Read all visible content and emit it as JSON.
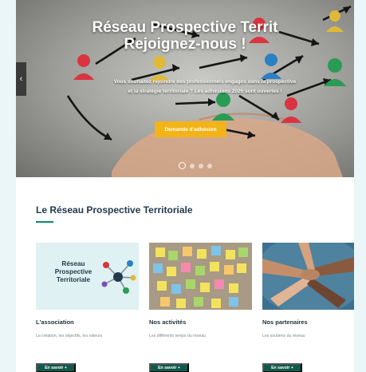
{
  "hero": {
    "title_line1": "Réseau Prospective Territ",
    "title_line2": "Rejoignez-nous !",
    "text_line1": "Vous souhaitez rejoindre des professionnels engagés dans la prospective",
    "text_line2": "et la stratégie territoriale ? Les adhésions 2026 sont ouvertes !",
    "cta_label": "Demande d'adhésion",
    "prev_arrow": "‹",
    "slide_count": 4,
    "active_slide": 1
  },
  "section": {
    "title": "Le Réseau Prospective Territoriale"
  },
  "logo": {
    "line1": "Réseau",
    "line2": "Prospective",
    "line3": "Territoriale"
  },
  "cards": [
    {
      "title": "L'association",
      "desc": "La création, les objectifs, les valeurs",
      "btn": "En savoir +"
    },
    {
      "title": "Nos activités",
      "desc": "Les différents temps du réseau",
      "btn": "En savoir +"
    },
    {
      "title": "Nos partenaires",
      "desc": "Les soutiens du réseau",
      "btn": "En savoir +"
    }
  ],
  "colors": {
    "page_bg": "#eaf6f7",
    "accent_green": "#0e5b4e",
    "cta_yellow": "#f2b418",
    "logo_card_bg": "#dff1f2"
  }
}
